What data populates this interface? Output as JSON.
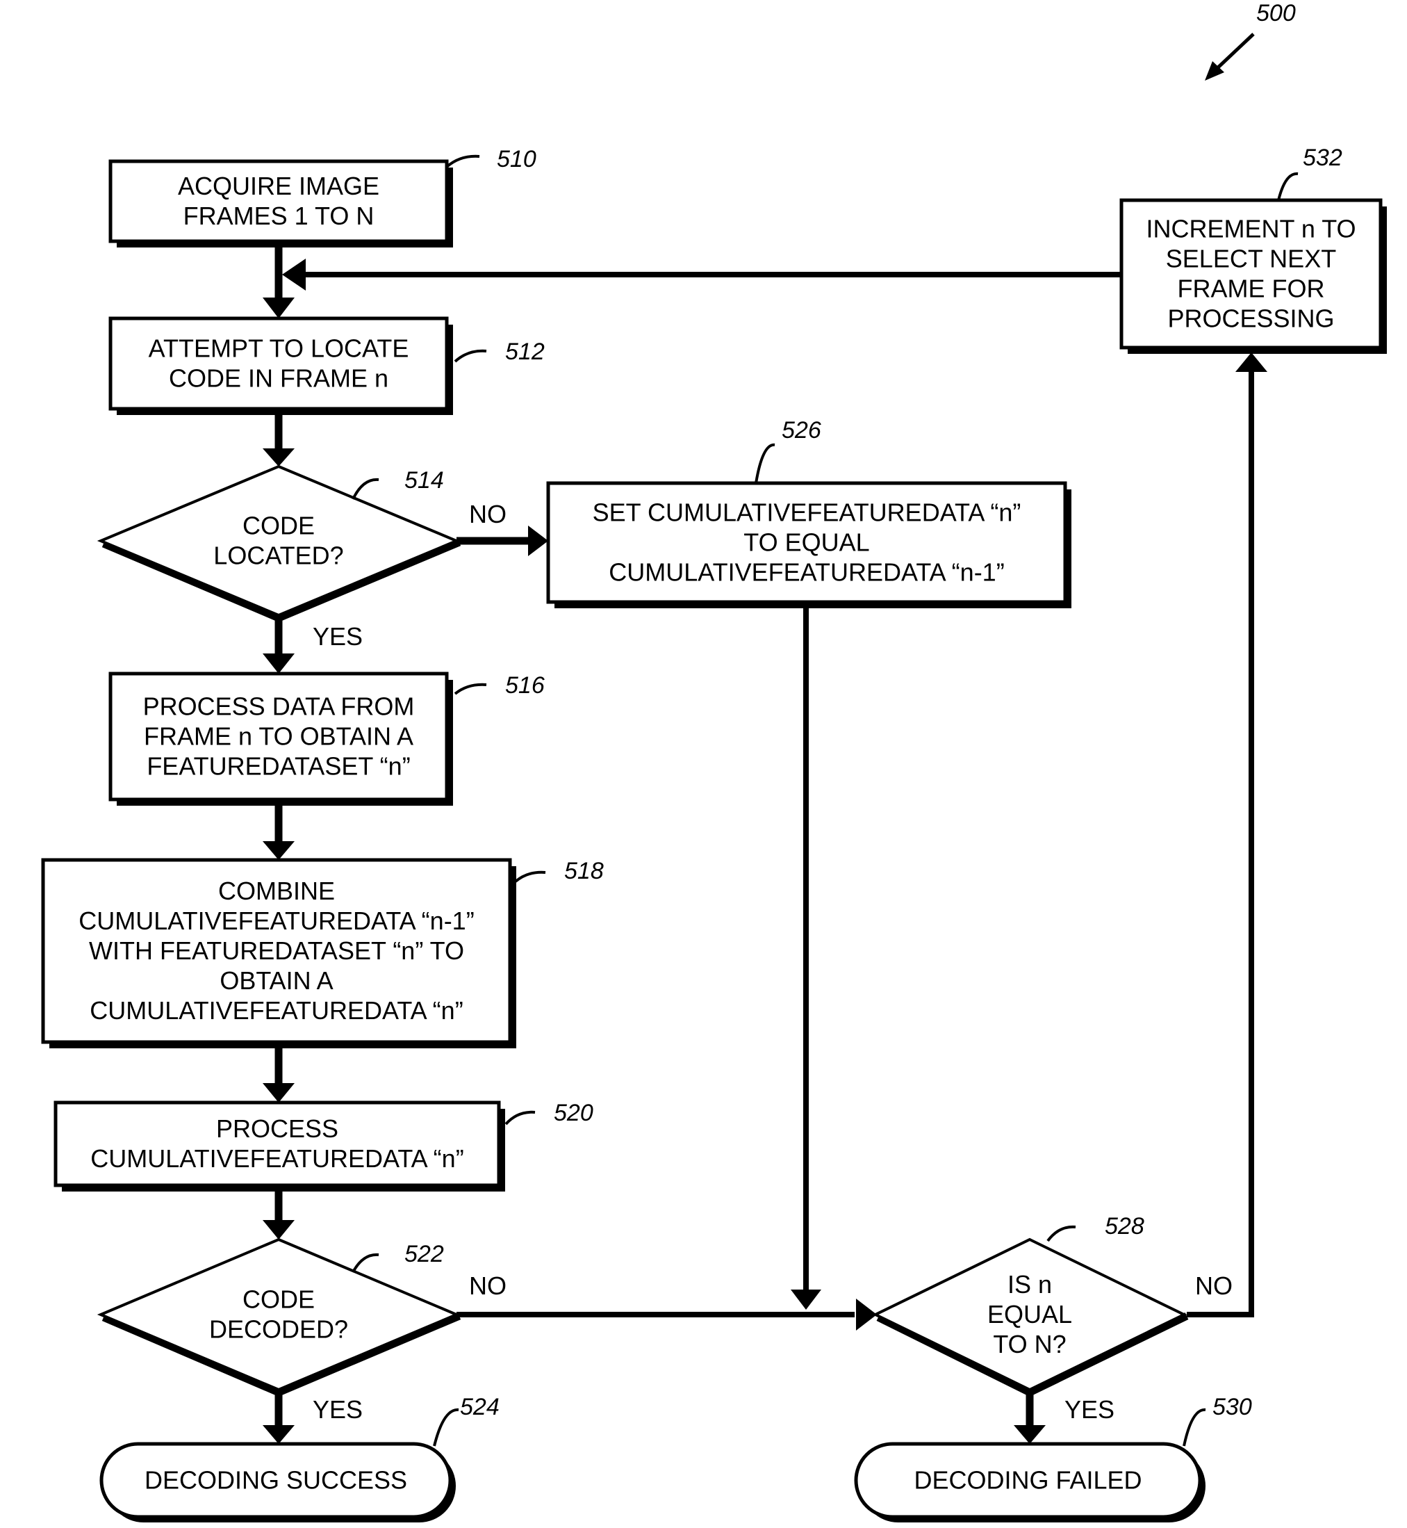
{
  "figure_ref": "500",
  "nodes": {
    "n510": {
      "ref": "510",
      "shape": "process",
      "lines": [
        "ACQUIRE IMAGE",
        "FRAMES 1 TO N"
      ]
    },
    "n512": {
      "ref": "512",
      "shape": "process",
      "lines": [
        "ATTEMPT TO LOCATE",
        "CODE IN FRAME n"
      ]
    },
    "n514": {
      "ref": "514",
      "shape": "decision",
      "lines": [
        "CODE",
        "LOCATED?"
      ]
    },
    "n516": {
      "ref": "516",
      "shape": "process",
      "lines": [
        "PROCESS DATA FROM",
        "FRAME n TO OBTAIN A",
        "FEATUREDATASET “n”"
      ]
    },
    "n518": {
      "ref": "518",
      "shape": "process",
      "lines": [
        "COMBINE",
        "CUMULATIVEFEATUREDATA “n-1”",
        "WITH  FEATUREDATASET “n” TO",
        "OBTAIN A",
        "CUMULATIVEFEATUREDATA “n”"
      ]
    },
    "n520": {
      "ref": "520",
      "shape": "process",
      "lines": [
        "PROCESS",
        "CUMULATIVEFEATUREDATA “n”"
      ]
    },
    "n522": {
      "ref": "522",
      "shape": "decision",
      "lines": [
        "CODE",
        "DECODED?"
      ]
    },
    "n524": {
      "ref": "524",
      "shape": "terminal",
      "lines": [
        "DECODING SUCCESS"
      ]
    },
    "n526": {
      "ref": "526",
      "shape": "process",
      "lines": [
        "SET CUMULATIVEFEATUREDATA “n”",
        "TO EQUAL",
        "CUMULATIVEFEATUREDATA “n-1”"
      ]
    },
    "n528": {
      "ref": "528",
      "shape": "decision",
      "lines": [
        "IS n",
        "EQUAL",
        "TO N?"
      ]
    },
    "n530": {
      "ref": "530",
      "shape": "terminal",
      "lines": [
        "DECODING FAILED"
      ]
    },
    "n532": {
      "ref": "532",
      "shape": "process",
      "lines": [
        "INCREMENT n TO",
        "SELECT NEXT",
        "FRAME FOR",
        "PROCESSING"
      ]
    }
  },
  "edge_labels": {
    "e514_no": "NO",
    "e514_yes": "YES",
    "e522_no": "NO",
    "e522_yes": "YES",
    "e528_no": "NO",
    "e528_yes": "YES"
  }
}
